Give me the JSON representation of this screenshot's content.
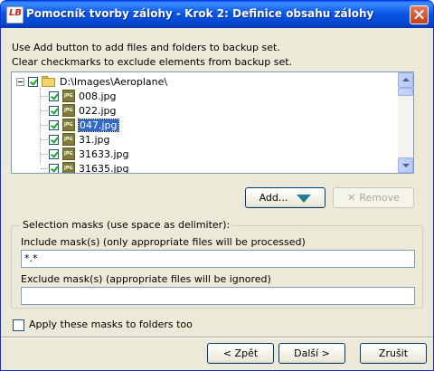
{
  "window": {
    "title": "Pomocník tvorby zálohy - Krok 2: Definice obsahu zálohy",
    "icon_text": "LB"
  },
  "instructions": {
    "line1": "Use Add button to add files and folders to backup set.",
    "line2": "Clear checkmarks to exclude elements from backup set."
  },
  "tree": {
    "root": {
      "label": "D:\\Images\\Aeroplane\\",
      "checked": true
    },
    "items": [
      {
        "label": "008.jpg",
        "checked": true,
        "selected": false
      },
      {
        "label": "022.jpg",
        "checked": true,
        "selected": false
      },
      {
        "label": "047.jpg",
        "checked": true,
        "selected": true
      },
      {
        "label": "31.jpg",
        "checked": true,
        "selected": false
      },
      {
        "label": "31633.jpg",
        "checked": true,
        "selected": false
      },
      {
        "label": "31635.jpg",
        "checked": true,
        "selected": false
      }
    ],
    "file_icon_text": "JPG"
  },
  "buttons": {
    "add": "Add...",
    "remove": "Remove"
  },
  "masks": {
    "group_title": "Selection masks (use space as delimiter):",
    "include_label": "Include mask(s) (only appropriate files will be processed)",
    "include_value": "*.*",
    "exclude_label": "Exclude mask(s) (appropriate files will be ignored)",
    "exclude_value": "",
    "apply_folders_label": "Apply these masks to folders too",
    "apply_folders_checked": false
  },
  "footer": {
    "back": "< Zpět",
    "next": "Další >",
    "cancel": "Zrušit"
  },
  "colors": {
    "titlebar": "#0b57e6",
    "selection": "#316ac5",
    "window_bg": "#ece9d8"
  }
}
